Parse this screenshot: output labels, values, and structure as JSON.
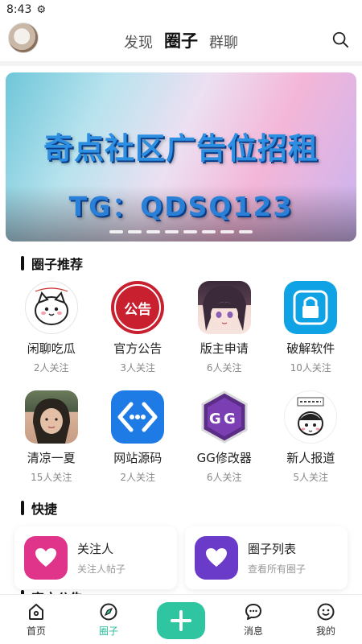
{
  "status_bar": {
    "time": "8:43",
    "icon": "gear-icon"
  },
  "header": {
    "tabs": [
      {
        "label": "发现",
        "active": false
      },
      {
        "label": "圈子",
        "active": true
      },
      {
        "label": "群聊",
        "active": false
      }
    ],
    "icons": {
      "avatar": "avatar",
      "search": "search-icon"
    }
  },
  "banner": {
    "title": "奇点社区广告位招租",
    "subtitle": "TG：QDSQ123",
    "page_count": 8,
    "colors": {
      "text": "#2c8fe2",
      "shadow": "#0b3d88"
    }
  },
  "circles_section": {
    "title": "圈子推荐",
    "items": [
      {
        "name": "闲聊吃瓜",
        "follow": "2人关注",
        "icon": "cat-sticker-icon"
      },
      {
        "name": "官方公告",
        "follow": "3人关注",
        "icon": "announcement-seal-icon",
        "icon_text": "公告"
      },
      {
        "name": "版主申请",
        "follow": "6人关注",
        "icon": "anime-girl-icon"
      },
      {
        "name": "破解软件",
        "follow": "10人关注",
        "icon": "lock-icon"
      },
      {
        "name": "清凉一夏",
        "follow": "15人关注",
        "icon": "photo-avatar-icon"
      },
      {
        "name": "网站源码",
        "follow": "2人关注",
        "icon": "code-brackets-icon"
      },
      {
        "name": "GG修改器",
        "follow": "6人关注",
        "icon": "gg-logo-icon"
      },
      {
        "name": "新人报道",
        "follow": "5人关注",
        "icon": "newbie-sticker-icon"
      }
    ]
  },
  "quick_section": {
    "title": "快捷",
    "cards": [
      {
        "title": "关注人",
        "subtitle": "关注人帖子",
        "icon": "heart-icon",
        "color": "#e0338a"
      },
      {
        "title": "圈子列表",
        "subtitle": "查看所有圈子",
        "icon": "heart-icon",
        "color": "#6a3bc8"
      }
    ]
  },
  "next_section": {
    "title": "官方公告"
  },
  "bottom_nav": {
    "items": [
      {
        "label": "首页",
        "icon": "home-icon",
        "active": false
      },
      {
        "label": "圈子",
        "icon": "compass-icon",
        "active": true
      },
      {
        "label": "",
        "icon": "plus-icon",
        "active": false
      },
      {
        "label": "消息",
        "icon": "message-icon",
        "active": false
      },
      {
        "label": "我的",
        "icon": "smile-icon",
        "active": false
      }
    ],
    "accent": "#2ec5a0"
  }
}
